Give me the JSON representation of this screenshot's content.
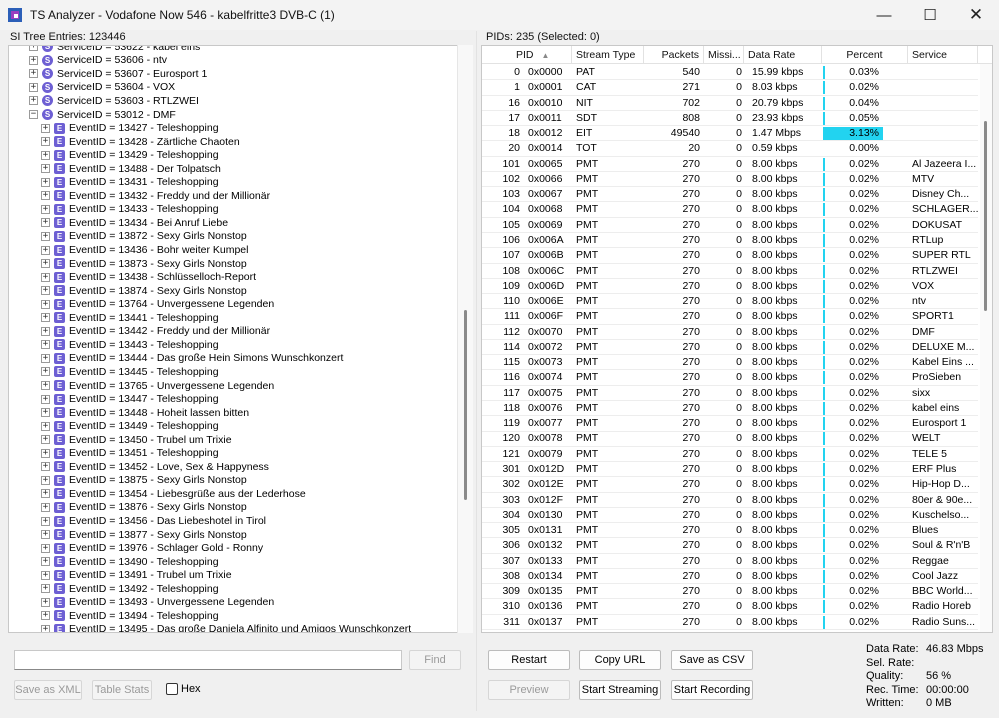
{
  "window": {
    "title": "TS Analyzer - Vodafone Now 546 - kabelfritte3 DVB-C (1)",
    "minimize": "—",
    "maximize": "☐",
    "close": "✕"
  },
  "left_panel": {
    "header": "SI Tree Entries: 123446",
    "tree": [
      {
        "level": 1,
        "icon": "S",
        "text": "ServiceID = 53622 - kabel eins"
      },
      {
        "level": 1,
        "icon": "S",
        "text": "ServiceID = 53606 - ntv"
      },
      {
        "level": 1,
        "icon": "S",
        "text": "ServiceID = 53607 - Eurosport 1"
      },
      {
        "level": 1,
        "icon": "S",
        "text": "ServiceID = 53604 - VOX"
      },
      {
        "level": 1,
        "icon": "S",
        "text": "ServiceID = 53603 - RTLZWEI"
      },
      {
        "level": 1,
        "icon": "S",
        "text": "ServiceID = 53012 - DMF",
        "expanded": true
      },
      {
        "level": 2,
        "icon": "E",
        "text": "EventID = 13427 - Teleshopping"
      },
      {
        "level": 2,
        "icon": "E",
        "text": "EventID = 13428 - Zärtliche Chaoten"
      },
      {
        "level": 2,
        "icon": "E",
        "text": "EventID = 13429 - Teleshopping"
      },
      {
        "level": 2,
        "icon": "E",
        "text": "EventID = 13488 - Der Tolpatsch"
      },
      {
        "level": 2,
        "icon": "E",
        "text": "EventID = 13431 - Teleshopping"
      },
      {
        "level": 2,
        "icon": "E",
        "text": "EventID = 13432 - Freddy und der Millionär"
      },
      {
        "level": 2,
        "icon": "E",
        "text": "EventID = 13433 - Teleshopping"
      },
      {
        "level": 2,
        "icon": "E",
        "text": "EventID = 13434 - Bei Anruf Liebe"
      },
      {
        "level": 2,
        "icon": "E",
        "text": "EventID = 13872 - Sexy Girls Nonstop"
      },
      {
        "level": 2,
        "icon": "E",
        "text": "EventID = 13436 - Bohr weiter Kumpel"
      },
      {
        "level": 2,
        "icon": "E",
        "text": "EventID = 13873 - Sexy Girls Nonstop"
      },
      {
        "level": 2,
        "icon": "E",
        "text": "EventID = 13438 - Schlüsselloch-Report"
      },
      {
        "level": 2,
        "icon": "E",
        "text": "EventID = 13874 - Sexy Girls Nonstop"
      },
      {
        "level": 2,
        "icon": "E",
        "text": "EventID = 13764 - Unvergessene Legenden"
      },
      {
        "level": 2,
        "icon": "E",
        "text": "EventID = 13441 - Teleshopping"
      },
      {
        "level": 2,
        "icon": "E",
        "text": "EventID = 13442 - Freddy und der Millionär"
      },
      {
        "level": 2,
        "icon": "E",
        "text": "EventID = 13443 - Teleshopping"
      },
      {
        "level": 2,
        "icon": "E",
        "text": "EventID = 13444 - Das große Hein Simons Wunschkonzert"
      },
      {
        "level": 2,
        "icon": "E",
        "text": "EventID = 13445 - Teleshopping"
      },
      {
        "level": 2,
        "icon": "E",
        "text": "EventID = 13765 - Unvergessene Legenden"
      },
      {
        "level": 2,
        "icon": "E",
        "text": "EventID = 13447 - Teleshopping"
      },
      {
        "level": 2,
        "icon": "E",
        "text": "EventID = 13448 - Hoheit lassen bitten"
      },
      {
        "level": 2,
        "icon": "E",
        "text": "EventID = 13449 - Teleshopping"
      },
      {
        "level": 2,
        "icon": "E",
        "text": "EventID = 13450 - Trubel um Trixie"
      },
      {
        "level": 2,
        "icon": "E",
        "text": "EventID = 13451 - Teleshopping"
      },
      {
        "level": 2,
        "icon": "E",
        "text": "EventID = 13452 - Love, Sex & Happyness"
      },
      {
        "level": 2,
        "icon": "E",
        "text": "EventID = 13875 - Sexy Girls Nonstop"
      },
      {
        "level": 2,
        "icon": "E",
        "text": "EventID = 13454 - Liebesgrüße aus der Lederhose"
      },
      {
        "level": 2,
        "icon": "E",
        "text": "EventID = 13876 - Sexy Girls Nonstop"
      },
      {
        "level": 2,
        "icon": "E",
        "text": "EventID = 13456 - Das Liebeshotel in Tirol"
      },
      {
        "level": 2,
        "icon": "E",
        "text": "EventID = 13877 - Sexy Girls Nonstop"
      },
      {
        "level": 2,
        "icon": "E",
        "text": "EventID = 13976 - Schlager Gold - Ronny"
      },
      {
        "level": 2,
        "icon": "E",
        "text": "EventID = 13490 - Teleshopping"
      },
      {
        "level": 2,
        "icon": "E",
        "text": "EventID = 13491 - Trubel um Trixie"
      },
      {
        "level": 2,
        "icon": "E",
        "text": "EventID = 13492 - Teleshopping"
      },
      {
        "level": 2,
        "icon": "E",
        "text": "EventID = 13493 - Unvergessene Legenden"
      },
      {
        "level": 2,
        "icon": "E",
        "text": "EventID = 13494 - Teleshopping"
      },
      {
        "level": 2,
        "icon": "E",
        "text": "EventID = 13495 - Das große Daniela Alfinito und Amigos Wunschkonzert"
      }
    ],
    "find_placeholder": "",
    "find_button": "Find",
    "save_xml_button": "Save as XML",
    "table_stats_button": "Table Stats",
    "hex_label": "Hex"
  },
  "right_panel": {
    "header": "PIDs: 235   (Selected: 0)",
    "columns": [
      "PID",
      "Stream Type",
      "Packets",
      "Missi...",
      "Data Rate",
      "Percent",
      "Service"
    ],
    "sort_indicator": "▲",
    "highlight_color": "#22d3f0",
    "rows": [
      {
        "pid": "0",
        "hex": "0x0000",
        "type": "PAT",
        "packets": "540",
        "missing": "0",
        "rate": "15.99 kbps",
        "percent": "0.03%",
        "pct_value": 0.03,
        "service": ""
      },
      {
        "pid": "1",
        "hex": "0x0001",
        "type": "CAT",
        "packets": "271",
        "missing": "0",
        "rate": "8.03 kbps",
        "percent": "0.02%",
        "pct_value": 0.02,
        "service": ""
      },
      {
        "pid": "16",
        "hex": "0x0010",
        "type": "NIT",
        "packets": "702",
        "missing": "0",
        "rate": "20.79 kbps",
        "percent": "0.04%",
        "pct_value": 0.04,
        "service": ""
      },
      {
        "pid": "17",
        "hex": "0x0011",
        "type": "SDT",
        "packets": "808",
        "missing": "0",
        "rate": "23.93 kbps",
        "percent": "0.05%",
        "pct_value": 0.05,
        "service": ""
      },
      {
        "pid": "18",
        "hex": "0x0012",
        "type": "EIT",
        "packets": "49540",
        "missing": "0",
        "rate": "1.47 Mbps",
        "percent": "3.13%",
        "pct_value": 3.13,
        "service": ""
      },
      {
        "pid": "20",
        "hex": "0x0014",
        "type": "TOT",
        "packets": "20",
        "missing": "0",
        "rate": "0.59 kbps",
        "percent": "0.00%",
        "pct_value": 0.0,
        "service": ""
      },
      {
        "pid": "101",
        "hex": "0x0065",
        "type": "PMT",
        "packets": "270",
        "missing": "0",
        "rate": "8.00 kbps",
        "percent": "0.02%",
        "pct_value": 0.02,
        "service": "Al Jazeera I..."
      },
      {
        "pid": "102",
        "hex": "0x0066",
        "type": "PMT",
        "packets": "270",
        "missing": "0",
        "rate": "8.00 kbps",
        "percent": "0.02%",
        "pct_value": 0.02,
        "service": "MTV"
      },
      {
        "pid": "103",
        "hex": "0x0067",
        "type": "PMT",
        "packets": "270",
        "missing": "0",
        "rate": "8.00 kbps",
        "percent": "0.02%",
        "pct_value": 0.02,
        "service": "Disney Ch..."
      },
      {
        "pid": "104",
        "hex": "0x0068",
        "type": "PMT",
        "packets": "270",
        "missing": "0",
        "rate": "8.00 kbps",
        "percent": "0.02%",
        "pct_value": 0.02,
        "service": "SCHLAGER..."
      },
      {
        "pid": "105",
        "hex": "0x0069",
        "type": "PMT",
        "packets": "270",
        "missing": "0",
        "rate": "8.00 kbps",
        "percent": "0.02%",
        "pct_value": 0.02,
        "service": "DOKUSAT"
      },
      {
        "pid": "106",
        "hex": "0x006A",
        "type": "PMT",
        "packets": "270",
        "missing": "0",
        "rate": "8.00 kbps",
        "percent": "0.02%",
        "pct_value": 0.02,
        "service": "RTLup"
      },
      {
        "pid": "107",
        "hex": "0x006B",
        "type": "PMT",
        "packets": "270",
        "missing": "0",
        "rate": "8.00 kbps",
        "percent": "0.02%",
        "pct_value": 0.02,
        "service": "SUPER RTL"
      },
      {
        "pid": "108",
        "hex": "0x006C",
        "type": "PMT",
        "packets": "270",
        "missing": "0",
        "rate": "8.00 kbps",
        "percent": "0.02%",
        "pct_value": 0.02,
        "service": "RTLZWEI"
      },
      {
        "pid": "109",
        "hex": "0x006D",
        "type": "PMT",
        "packets": "270",
        "missing": "0",
        "rate": "8.00 kbps",
        "percent": "0.02%",
        "pct_value": 0.02,
        "service": "VOX"
      },
      {
        "pid": "110",
        "hex": "0x006E",
        "type": "PMT",
        "packets": "270",
        "missing": "0",
        "rate": "8.00 kbps",
        "percent": "0.02%",
        "pct_value": 0.02,
        "service": "ntv"
      },
      {
        "pid": "111",
        "hex": "0x006F",
        "type": "PMT",
        "packets": "270",
        "missing": "0",
        "rate": "8.00 kbps",
        "percent": "0.02%",
        "pct_value": 0.02,
        "service": "SPORT1"
      },
      {
        "pid": "112",
        "hex": "0x0070",
        "type": "PMT",
        "packets": "270",
        "missing": "0",
        "rate": "8.00 kbps",
        "percent": "0.02%",
        "pct_value": 0.02,
        "service": "DMF"
      },
      {
        "pid": "114",
        "hex": "0x0072",
        "type": "PMT",
        "packets": "270",
        "missing": "0",
        "rate": "8.00 kbps",
        "percent": "0.02%",
        "pct_value": 0.02,
        "service": "DELUXE M..."
      },
      {
        "pid": "115",
        "hex": "0x0073",
        "type": "PMT",
        "packets": "270",
        "missing": "0",
        "rate": "8.00 kbps",
        "percent": "0.02%",
        "pct_value": 0.02,
        "service": "Kabel Eins ..."
      },
      {
        "pid": "116",
        "hex": "0x0074",
        "type": "PMT",
        "packets": "270",
        "missing": "0",
        "rate": "8.00 kbps",
        "percent": "0.02%",
        "pct_value": 0.02,
        "service": "ProSieben"
      },
      {
        "pid": "117",
        "hex": "0x0075",
        "type": "PMT",
        "packets": "270",
        "missing": "0",
        "rate": "8.00 kbps",
        "percent": "0.02%",
        "pct_value": 0.02,
        "service": "sixx"
      },
      {
        "pid": "118",
        "hex": "0x0076",
        "type": "PMT",
        "packets": "270",
        "missing": "0",
        "rate": "8.00 kbps",
        "percent": "0.02%",
        "pct_value": 0.02,
        "service": "kabel eins"
      },
      {
        "pid": "119",
        "hex": "0x0077",
        "type": "PMT",
        "packets": "270",
        "missing": "0",
        "rate": "8.00 kbps",
        "percent": "0.02%",
        "pct_value": 0.02,
        "service": "Eurosport 1"
      },
      {
        "pid": "120",
        "hex": "0x0078",
        "type": "PMT",
        "packets": "270",
        "missing": "0",
        "rate": "8.00 kbps",
        "percent": "0.02%",
        "pct_value": 0.02,
        "service": "WELT"
      },
      {
        "pid": "121",
        "hex": "0x0079",
        "type": "PMT",
        "packets": "270",
        "missing": "0",
        "rate": "8.00 kbps",
        "percent": "0.02%",
        "pct_value": 0.02,
        "service": "TELE 5"
      },
      {
        "pid": "301",
        "hex": "0x012D",
        "type": "PMT",
        "packets": "270",
        "missing": "0",
        "rate": "8.00 kbps",
        "percent": "0.02%",
        "pct_value": 0.02,
        "service": "ERF Plus"
      },
      {
        "pid": "302",
        "hex": "0x012E",
        "type": "PMT",
        "packets": "270",
        "missing": "0",
        "rate": "8.00 kbps",
        "percent": "0.02%",
        "pct_value": 0.02,
        "service": "Hip-Hop D..."
      },
      {
        "pid": "303",
        "hex": "0x012F",
        "type": "PMT",
        "packets": "270",
        "missing": "0",
        "rate": "8.00 kbps",
        "percent": "0.02%",
        "pct_value": 0.02,
        "service": "80er & 90e..."
      },
      {
        "pid": "304",
        "hex": "0x0130",
        "type": "PMT",
        "packets": "270",
        "missing": "0",
        "rate": "8.00 kbps",
        "percent": "0.02%",
        "pct_value": 0.02,
        "service": "Kuschelso..."
      },
      {
        "pid": "305",
        "hex": "0x0131",
        "type": "PMT",
        "packets": "270",
        "missing": "0",
        "rate": "8.00 kbps",
        "percent": "0.02%",
        "pct_value": 0.02,
        "service": "Blues"
      },
      {
        "pid": "306",
        "hex": "0x0132",
        "type": "PMT",
        "packets": "270",
        "missing": "0",
        "rate": "8.00 kbps",
        "percent": "0.02%",
        "pct_value": 0.02,
        "service": "Soul & R'n'B"
      },
      {
        "pid": "307",
        "hex": "0x0133",
        "type": "PMT",
        "packets": "270",
        "missing": "0",
        "rate": "8.00 kbps",
        "percent": "0.02%",
        "pct_value": 0.02,
        "service": "Reggae"
      },
      {
        "pid": "308",
        "hex": "0x0134",
        "type": "PMT",
        "packets": "270",
        "missing": "0",
        "rate": "8.00 kbps",
        "percent": "0.02%",
        "pct_value": 0.02,
        "service": "Cool Jazz"
      },
      {
        "pid": "309",
        "hex": "0x0135",
        "type": "PMT",
        "packets": "270",
        "missing": "0",
        "rate": "8.00 kbps",
        "percent": "0.02%",
        "pct_value": 0.02,
        "service": "BBC World..."
      },
      {
        "pid": "310",
        "hex": "0x0136",
        "type": "PMT",
        "packets": "270",
        "missing": "0",
        "rate": "8.00 kbps",
        "percent": "0.02%",
        "pct_value": 0.02,
        "service": "Radio Horeb"
      },
      {
        "pid": "311",
        "hex": "0x0137",
        "type": "PMT",
        "packets": "270",
        "missing": "0",
        "rate": "8.00 kbps",
        "percent": "0.02%",
        "pct_value": 0.02,
        "service": "Radio Suns..."
      }
    ],
    "buttons": {
      "restart": "Restart",
      "copy_url": "Copy URL",
      "save_csv": "Save as CSV",
      "preview": "Preview",
      "start_streaming": "Start Streaming",
      "start_recording": "Start Recording"
    },
    "stats": [
      {
        "label": "Data Rate:",
        "value": "46.83 Mbps"
      },
      {
        "label": "Sel. Rate:",
        "value": ""
      },
      {
        "label": "Quality:",
        "value": "56 %"
      },
      {
        "label": "Rec. Time:",
        "value": "00:00:00"
      },
      {
        "label": "Written:",
        "value": "0 MB"
      }
    ]
  }
}
